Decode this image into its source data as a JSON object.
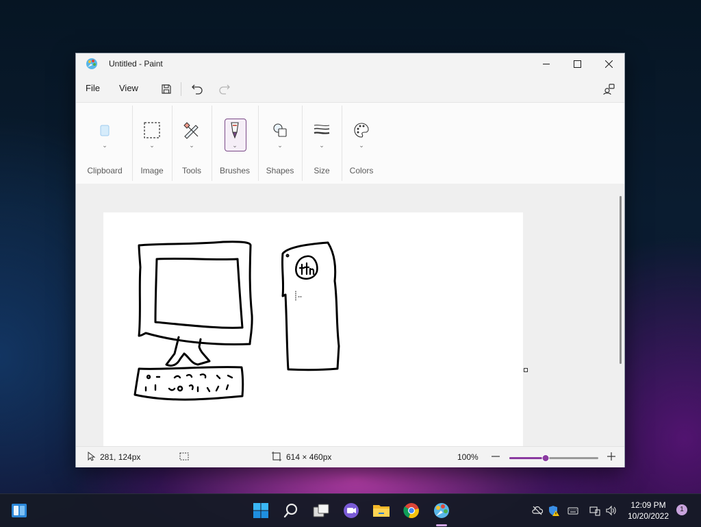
{
  "window": {
    "title": "Untitled - Paint",
    "app_icon": "paint-palette-icon"
  },
  "menu": {
    "file": "File",
    "view": "View",
    "icons": [
      "save-icon",
      "undo-icon",
      "redo-icon",
      "share-icon"
    ]
  },
  "ribbon": {
    "groups": [
      {
        "label": "Clipboard",
        "icon": "clipboard-icon"
      },
      {
        "label": "Image",
        "icon": "selection-icon"
      },
      {
        "label": "Tools",
        "icon": "pencil-eraser-icon"
      },
      {
        "label": "Brushes",
        "icon": "brush-icon"
      },
      {
        "label": "Shapes",
        "icon": "shapes-icon"
      },
      {
        "label": "Size",
        "icon": "line-size-icon"
      },
      {
        "label": "Colors",
        "icon": "palette-icon"
      }
    ]
  },
  "canvas": {
    "drawing": "computer sketch"
  },
  "status": {
    "cursor_position": "281, 124px",
    "canvas_size": "614 × 460px",
    "zoom": "100%",
    "zoom_level": 0.41
  },
  "taskbar": {
    "time": "12:09 PM",
    "date": "10/20/2022",
    "notification_count": "1"
  },
  "colors": {
    "accent": "#8a3aa0",
    "window_bg": "#f3f3f3",
    "canvas_bg": "#ffffff",
    "taskbar_bg": "#161a26"
  }
}
